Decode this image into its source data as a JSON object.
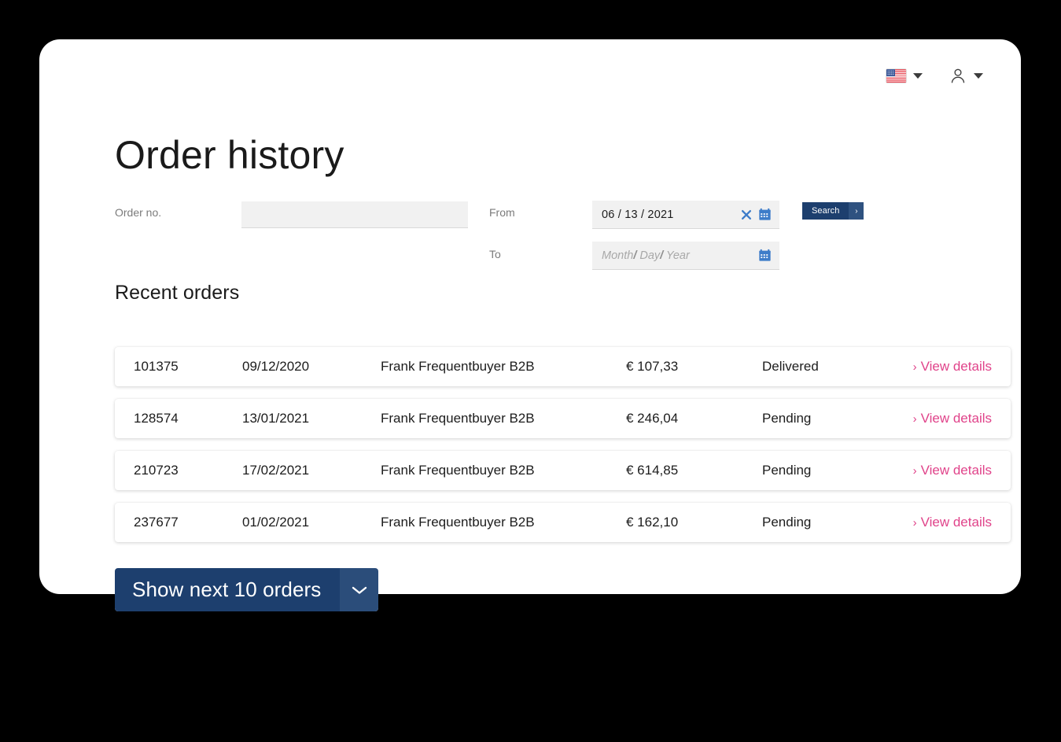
{
  "header": {
    "language_flag_icon": "us-flag-icon",
    "language_caret_icon": "chevron-down-icon",
    "account_icon": "user-icon",
    "account_caret_icon": "chevron-down-icon"
  },
  "page_title": "Order history",
  "form": {
    "order_no_label": "Order no.",
    "order_no_value": "",
    "order_no_placeholder": "",
    "from_label": "From",
    "from_value": "06 / 13 / 2021",
    "from_clear_icon": "close-x-icon",
    "from_calendar_icon": "calendar-icon",
    "to_label": "To",
    "to_placeholder_month": "Month",
    "to_placeholder_sep1": "/",
    "to_placeholder_day": "Day",
    "to_placeholder_sep2": "/",
    "to_placeholder_year": "Year",
    "to_calendar_icon": "calendar-icon",
    "search_label": "Search",
    "search_chevron": "›"
  },
  "section_title": "Recent orders",
  "orders": [
    {
      "id": "101375",
      "date": "09/12/2020",
      "customer": "Frank Frequentbuyer B2B",
      "amount": "€ 107,33",
      "status": "Delivered",
      "link": "View details",
      "link_arrow": "›"
    },
    {
      "id": "128574",
      "date": "13/01/2021",
      "customer": "Frank Frequentbuyer B2B",
      "amount": "€ 246,04",
      "status": "Pending",
      "link": "View details",
      "link_arrow": "›"
    },
    {
      "id": "210723",
      "date": "17/02/2021",
      "customer": "Frank Frequentbuyer B2B",
      "amount": "€ 614,85",
      "status": "Pending",
      "link": "View details",
      "link_arrow": "›"
    },
    {
      "id": "237677",
      "date": "01/02/2021",
      "customer": "Frank Frequentbuyer B2B",
      "amount": "€ 162,10",
      "status": "Pending",
      "link": "View details",
      "link_arrow": "›"
    }
  ],
  "footer": {
    "show_next_label": "Show next 10 orders",
    "show_next_caret_icon": "chevron-down-icon"
  },
  "colors": {
    "page_background": "#000000",
    "card_background": "#ffffff",
    "primary_navy": "#1d3f6e",
    "primary_navy_light": "#2f5280",
    "link_pink": "#e0438a",
    "icon_blue": "#3d7cc9",
    "input_fill": "#f1f1f1",
    "label_gray": "#7b7b7b"
  }
}
